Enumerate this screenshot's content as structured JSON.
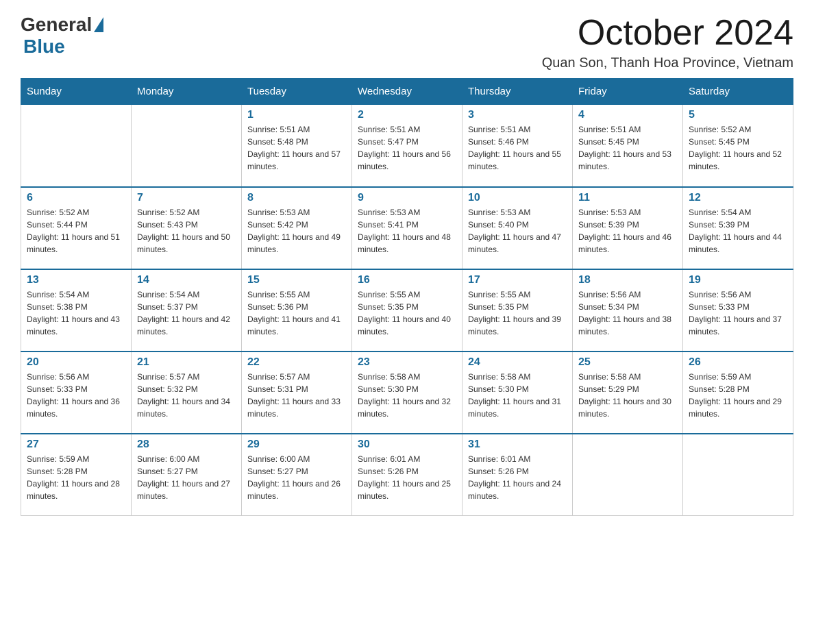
{
  "logo": {
    "general": "General",
    "blue": "Blue"
  },
  "title": {
    "month_year": "October 2024",
    "location": "Quan Son, Thanh Hoa Province, Vietnam"
  },
  "headers": [
    "Sunday",
    "Monday",
    "Tuesday",
    "Wednesday",
    "Thursday",
    "Friday",
    "Saturday"
  ],
  "weeks": [
    [
      {
        "day": "",
        "sunrise": "",
        "sunset": "",
        "daylight": ""
      },
      {
        "day": "",
        "sunrise": "",
        "sunset": "",
        "daylight": ""
      },
      {
        "day": "1",
        "sunrise": "Sunrise: 5:51 AM",
        "sunset": "Sunset: 5:48 PM",
        "daylight": "Daylight: 11 hours and 57 minutes."
      },
      {
        "day": "2",
        "sunrise": "Sunrise: 5:51 AM",
        "sunset": "Sunset: 5:47 PM",
        "daylight": "Daylight: 11 hours and 56 minutes."
      },
      {
        "day": "3",
        "sunrise": "Sunrise: 5:51 AM",
        "sunset": "Sunset: 5:46 PM",
        "daylight": "Daylight: 11 hours and 55 minutes."
      },
      {
        "day": "4",
        "sunrise": "Sunrise: 5:51 AM",
        "sunset": "Sunset: 5:45 PM",
        "daylight": "Daylight: 11 hours and 53 minutes."
      },
      {
        "day": "5",
        "sunrise": "Sunrise: 5:52 AM",
        "sunset": "Sunset: 5:45 PM",
        "daylight": "Daylight: 11 hours and 52 minutes."
      }
    ],
    [
      {
        "day": "6",
        "sunrise": "Sunrise: 5:52 AM",
        "sunset": "Sunset: 5:44 PM",
        "daylight": "Daylight: 11 hours and 51 minutes."
      },
      {
        "day": "7",
        "sunrise": "Sunrise: 5:52 AM",
        "sunset": "Sunset: 5:43 PM",
        "daylight": "Daylight: 11 hours and 50 minutes."
      },
      {
        "day": "8",
        "sunrise": "Sunrise: 5:53 AM",
        "sunset": "Sunset: 5:42 PM",
        "daylight": "Daylight: 11 hours and 49 minutes."
      },
      {
        "day": "9",
        "sunrise": "Sunrise: 5:53 AM",
        "sunset": "Sunset: 5:41 PM",
        "daylight": "Daylight: 11 hours and 48 minutes."
      },
      {
        "day": "10",
        "sunrise": "Sunrise: 5:53 AM",
        "sunset": "Sunset: 5:40 PM",
        "daylight": "Daylight: 11 hours and 47 minutes."
      },
      {
        "day": "11",
        "sunrise": "Sunrise: 5:53 AM",
        "sunset": "Sunset: 5:39 PM",
        "daylight": "Daylight: 11 hours and 46 minutes."
      },
      {
        "day": "12",
        "sunrise": "Sunrise: 5:54 AM",
        "sunset": "Sunset: 5:39 PM",
        "daylight": "Daylight: 11 hours and 44 minutes."
      }
    ],
    [
      {
        "day": "13",
        "sunrise": "Sunrise: 5:54 AM",
        "sunset": "Sunset: 5:38 PM",
        "daylight": "Daylight: 11 hours and 43 minutes."
      },
      {
        "day": "14",
        "sunrise": "Sunrise: 5:54 AM",
        "sunset": "Sunset: 5:37 PM",
        "daylight": "Daylight: 11 hours and 42 minutes."
      },
      {
        "day": "15",
        "sunrise": "Sunrise: 5:55 AM",
        "sunset": "Sunset: 5:36 PM",
        "daylight": "Daylight: 11 hours and 41 minutes."
      },
      {
        "day": "16",
        "sunrise": "Sunrise: 5:55 AM",
        "sunset": "Sunset: 5:35 PM",
        "daylight": "Daylight: 11 hours and 40 minutes."
      },
      {
        "day": "17",
        "sunrise": "Sunrise: 5:55 AM",
        "sunset": "Sunset: 5:35 PM",
        "daylight": "Daylight: 11 hours and 39 minutes."
      },
      {
        "day": "18",
        "sunrise": "Sunrise: 5:56 AM",
        "sunset": "Sunset: 5:34 PM",
        "daylight": "Daylight: 11 hours and 38 minutes."
      },
      {
        "day": "19",
        "sunrise": "Sunrise: 5:56 AM",
        "sunset": "Sunset: 5:33 PM",
        "daylight": "Daylight: 11 hours and 37 minutes."
      }
    ],
    [
      {
        "day": "20",
        "sunrise": "Sunrise: 5:56 AM",
        "sunset": "Sunset: 5:33 PM",
        "daylight": "Daylight: 11 hours and 36 minutes."
      },
      {
        "day": "21",
        "sunrise": "Sunrise: 5:57 AM",
        "sunset": "Sunset: 5:32 PM",
        "daylight": "Daylight: 11 hours and 34 minutes."
      },
      {
        "day": "22",
        "sunrise": "Sunrise: 5:57 AM",
        "sunset": "Sunset: 5:31 PM",
        "daylight": "Daylight: 11 hours and 33 minutes."
      },
      {
        "day": "23",
        "sunrise": "Sunrise: 5:58 AM",
        "sunset": "Sunset: 5:30 PM",
        "daylight": "Daylight: 11 hours and 32 minutes."
      },
      {
        "day": "24",
        "sunrise": "Sunrise: 5:58 AM",
        "sunset": "Sunset: 5:30 PM",
        "daylight": "Daylight: 11 hours and 31 minutes."
      },
      {
        "day": "25",
        "sunrise": "Sunrise: 5:58 AM",
        "sunset": "Sunset: 5:29 PM",
        "daylight": "Daylight: 11 hours and 30 minutes."
      },
      {
        "day": "26",
        "sunrise": "Sunrise: 5:59 AM",
        "sunset": "Sunset: 5:28 PM",
        "daylight": "Daylight: 11 hours and 29 minutes."
      }
    ],
    [
      {
        "day": "27",
        "sunrise": "Sunrise: 5:59 AM",
        "sunset": "Sunset: 5:28 PM",
        "daylight": "Daylight: 11 hours and 28 minutes."
      },
      {
        "day": "28",
        "sunrise": "Sunrise: 6:00 AM",
        "sunset": "Sunset: 5:27 PM",
        "daylight": "Daylight: 11 hours and 27 minutes."
      },
      {
        "day": "29",
        "sunrise": "Sunrise: 6:00 AM",
        "sunset": "Sunset: 5:27 PM",
        "daylight": "Daylight: 11 hours and 26 minutes."
      },
      {
        "day": "30",
        "sunrise": "Sunrise: 6:01 AM",
        "sunset": "Sunset: 5:26 PM",
        "daylight": "Daylight: 11 hours and 25 minutes."
      },
      {
        "day": "31",
        "sunrise": "Sunrise: 6:01 AM",
        "sunset": "Sunset: 5:26 PM",
        "daylight": "Daylight: 11 hours and 24 minutes."
      },
      {
        "day": "",
        "sunrise": "",
        "sunset": "",
        "daylight": ""
      },
      {
        "day": "",
        "sunrise": "",
        "sunset": "",
        "daylight": ""
      }
    ]
  ]
}
